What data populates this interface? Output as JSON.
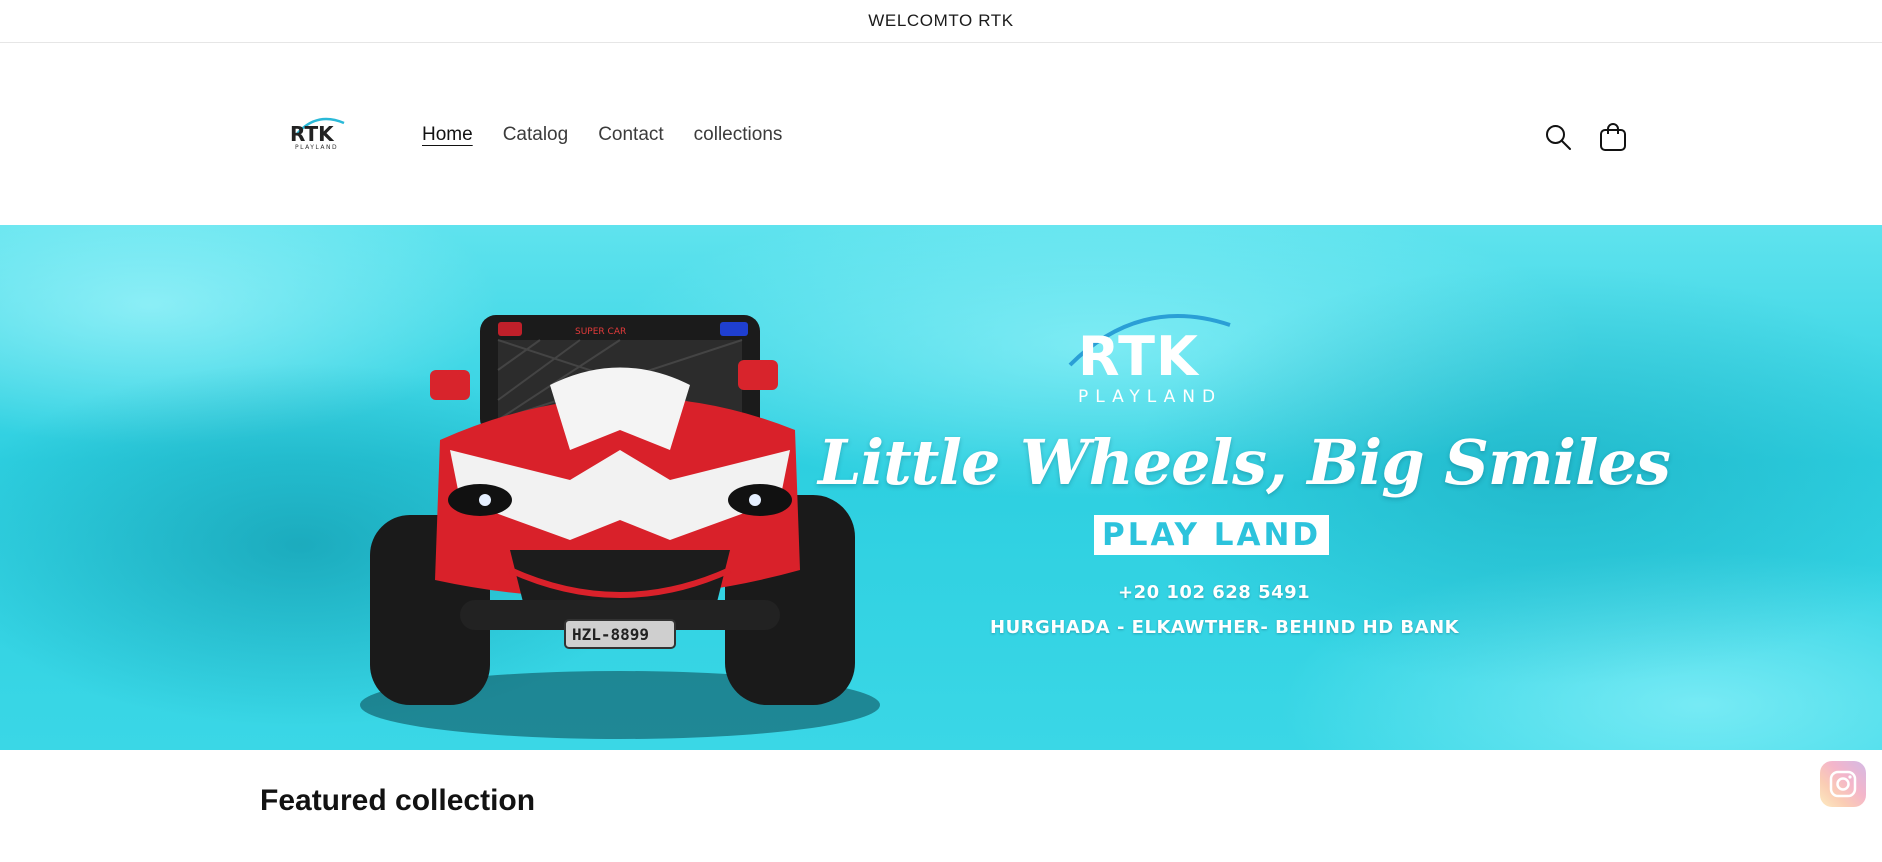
{
  "announcement": {
    "text": "WELCOMTO RTK"
  },
  "header": {
    "logo": {
      "brand": "RTK",
      "sub": "PLAYLAND"
    },
    "nav": [
      {
        "label": "Home",
        "active": true
      },
      {
        "label": "Catalog",
        "active": false
      },
      {
        "label": "Contact",
        "active": false
      },
      {
        "label": "collections",
        "active": false
      }
    ],
    "icons": {
      "search": "search-icon",
      "cart": "cart-icon"
    }
  },
  "hero": {
    "brand": "RTK",
    "brand_sub": "PLAYLAND",
    "tagline": "Little Wheels, Big Smiles",
    "badge": "PLAY LAND",
    "phone": "+20 102 628 5491",
    "address": "HURGHADA - ELKAWTHER- BEHIND HD BANK",
    "plate": "HZL-8899",
    "grille_text": "SUPER CAR"
  },
  "featured": {
    "title": "Featured collection"
  },
  "floating": {
    "icon": "instagram-icon"
  },
  "colors": {
    "hero_bg": "#2dcfe0",
    "badge_text": "#2cc3dc",
    "text": "#121212"
  }
}
